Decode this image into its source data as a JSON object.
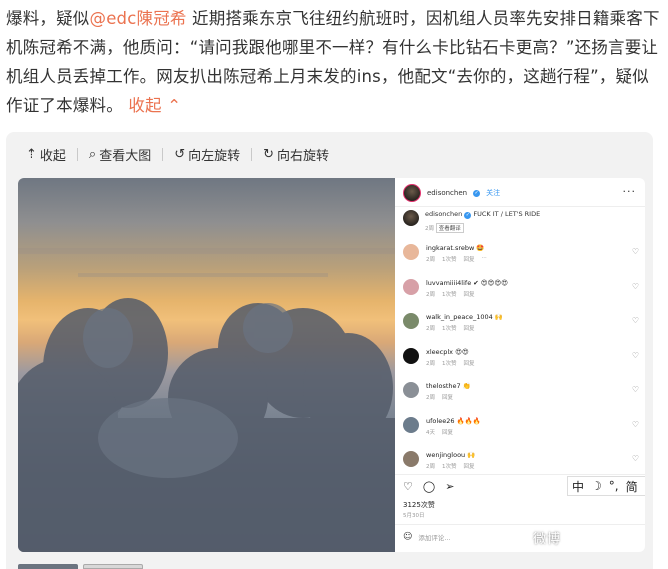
{
  "post": {
    "line1_pre": "爆料，疑似",
    "mention": "@edc陳冠希",
    "line1_post": " 近期搭乘东京飞往纽约航班时，因机组人员率先安排日籍乘客下机陈冠希不满，他质问：“请问我跟他哪里不一样？有什么卡比钻石卡更高？”还扬言要让机组人员丢掉工作。网友扒出陈冠希上月末发的ins，他配文“去你的，这趟行程”，疑似作证了本爆料。",
    "collapse_label": "收起"
  },
  "toolbar": {
    "collapse": "收起",
    "view_large": "查看大图",
    "rotate_left": "向左旋转",
    "rotate_right": "向右旋转"
  },
  "ig": {
    "username": "edisonchen",
    "follow": "关注",
    "caption_user": "edisonchen",
    "caption_text": "FUCK IT / LET'S RIDE",
    "caption_time": "2周",
    "translate": "查看翻译",
    "comments": [
      {
        "user": "ingkarat.srebw 🤩",
        "meta": [
          "2周",
          "1次赞",
          "回复",
          "···"
        ],
        "color": "#e8b79a"
      },
      {
        "user": "luvvamiiii4life ✔ 😍😍😍😍",
        "meta": [
          "2周",
          "1次赞",
          "回复"
        ],
        "color": "#d7a0a7"
      },
      {
        "user": "walk_in_peace_1004 🙌",
        "meta": [
          "2周",
          "1次赞",
          "回复"
        ],
        "color": "#7a8a6a"
      },
      {
        "user": "xleecplx 😍😍",
        "meta": [
          "2周",
          "1次赞",
          "回复"
        ],
        "color": "#111111"
      },
      {
        "user": "thelosthe7 👏",
        "meta": [
          "2周",
          "回复"
        ],
        "color": "#8a8f96"
      },
      {
        "user": "ufolee26 🔥🔥🔥",
        "meta": [
          "4天",
          "回复"
        ],
        "color": "#6c7c8c"
      },
      {
        "user": "wenjingloou 🙌",
        "meta": [
          "2周",
          "1次赞",
          "回复"
        ],
        "color": "#8a7a6a"
      }
    ],
    "likes": "3125次赞",
    "date": "5月30日",
    "add_comment": "添加评论..."
  },
  "ime": {
    "lang": "中",
    "moon": "☽",
    "mode": "°,",
    "simp": "简"
  },
  "watermark": "微博"
}
